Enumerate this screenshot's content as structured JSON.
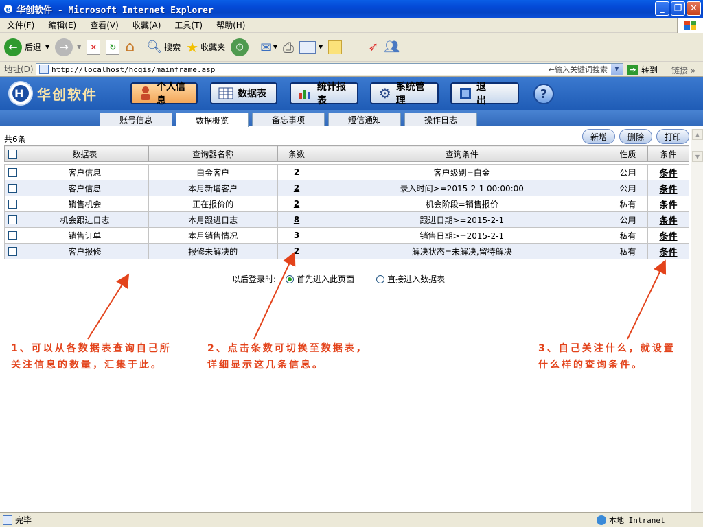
{
  "window": {
    "title": "华创软件 - Microsoft Internet Explorer"
  },
  "menu": [
    "文件(F)",
    "编辑(E)",
    "查看(V)",
    "收藏(A)",
    "工具(T)",
    "帮助(H)"
  ],
  "toolbar": {
    "back": "后退",
    "search": "搜索",
    "favorites": "收藏夹"
  },
  "address": {
    "label": "地址(D)",
    "url": "http://localhost/hcgis/mainframe.asp",
    "keyword_placeholder": "←输入关键词搜索",
    "go": "转到",
    "links": "链接"
  },
  "app": {
    "logo_text": "华创软件",
    "nav": [
      "个人信息",
      "数据表",
      "统计报表",
      "系统管理",
      "退 出"
    ],
    "help": "?",
    "tabs": [
      "账号信息",
      "数据概览",
      "备忘事项",
      "短信通知",
      "操作日志"
    ],
    "count_text": "共6条",
    "actions": {
      "add": "新增",
      "delete": "删除",
      "print": "打印"
    },
    "table": {
      "headers": [
        "数据表",
        "查询器名称",
        "条数",
        "查询条件",
        "性质",
        "条件"
      ],
      "rows": [
        {
          "table": "客户信息",
          "query": "白金客户",
          "count": "2",
          "condition": "客户级别=白金",
          "type": "公用",
          "link": "条件"
        },
        {
          "table": "客户信息",
          "query": "本月新增客户",
          "count": "2",
          "condition": "录入时间>=2015-2-1 00:00:00",
          "type": "公用",
          "link": "条件"
        },
        {
          "table": "销售机会",
          "query": "正在报价的",
          "count": "2",
          "condition": "机会阶段=销售报价",
          "type": "私有",
          "link": "条件"
        },
        {
          "table": "机会跟进日志",
          "query": "本月跟进日志",
          "count": "8",
          "condition": "跟进日期>=2015-2-1",
          "type": "公用",
          "link": "条件"
        },
        {
          "table": "销售订单",
          "query": "本月销售情况",
          "count": "3",
          "condition": "销售日期>=2015-2-1",
          "type": "私有",
          "link": "条件"
        },
        {
          "table": "客户报修",
          "query": "报修未解决的",
          "count": "2",
          "condition": "解决状态=未解决,留待解决",
          "type": "私有",
          "link": "条件"
        }
      ]
    },
    "login_pref": {
      "label": "以后登录时:",
      "option1": "首先进入此页面",
      "option2": "直接进入数据表"
    },
    "notes": {
      "n1_l1": "1、可以从各数据表查询自己所",
      "n1_l2": "关注信息的数量，汇集于此。",
      "n2_l1": "2、点击条数可切换至数据表，",
      "n2_l2": "详细显示这几条信息。",
      "n3_l1": "3、自己关注什么，就设置",
      "n3_l2": "什么样的查询条件。"
    },
    "colors": {
      "header": "#2a68c2",
      "annotation": "#e3431b"
    }
  },
  "status": {
    "left": "完毕",
    "zone": "本地 Intranet"
  }
}
